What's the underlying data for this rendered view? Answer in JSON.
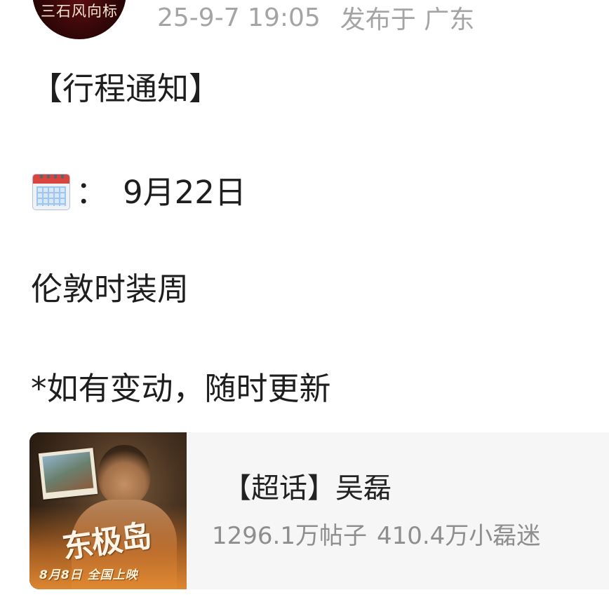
{
  "header": {
    "avatar_text": "三石风向标",
    "timestamp": "25-9-7 19:05",
    "location_text": "发布于 广东"
  },
  "post": {
    "line1": "【行程通知】",
    "date_icon": "calendar-icon",
    "date_separator": "：",
    "date_value": "9月22日",
    "event": "伦敦时装周",
    "note": "*如有变动，随时更新"
  },
  "card": {
    "poster_title": "东极岛",
    "poster_date": "8月8日  全国上映",
    "title": "【超话】吴磊",
    "posts_count": "1296.1万帖子",
    "fans_count": "410.4万小磊迷"
  }
}
